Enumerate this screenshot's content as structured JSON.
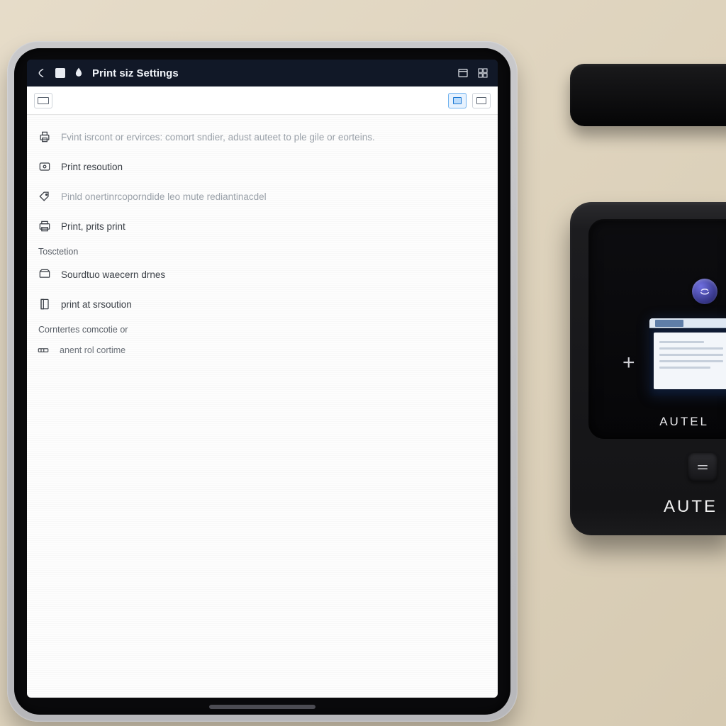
{
  "titlebar": {
    "title": "Print siz Settings"
  },
  "list": {
    "desc": "Fvint isrcont or ervirces: comort sndier, adust auteet to ple gile or eorteins.",
    "item_resolution": "Print resoution",
    "item_muted": "Pinld onertinrcoporndide leo mute rediantinacdel",
    "item_prints": "Print, prits print",
    "section1": "Tosctetion",
    "item_drives": "Sourdtuo waecern drnes",
    "item_at_res": "print at srsoution",
    "section2": "Corntertes comcotie or",
    "item_control": "anent rol cortime"
  },
  "device": {
    "brand_face": "AUTEL",
    "brand_body": "AUTE"
  }
}
